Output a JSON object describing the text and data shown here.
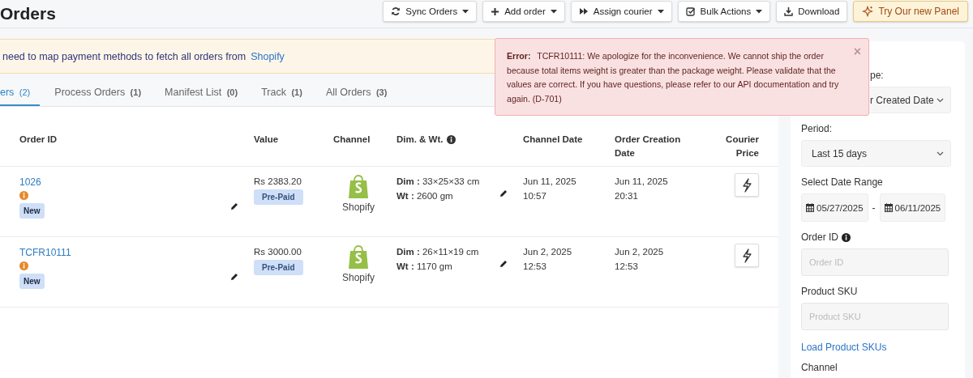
{
  "page": {
    "title": "Orders"
  },
  "toolbar": [
    {
      "label": "Sync Orders",
      "caret": true,
      "kind": "plain"
    },
    {
      "label": "Add order",
      "caret": true,
      "kind": "plain"
    },
    {
      "label": "Assign courier",
      "caret": true,
      "kind": "plain"
    },
    {
      "label": "Bulk Actions",
      "caret": true,
      "kind": "plain"
    },
    {
      "label": "Download",
      "kind": "plain"
    },
    {
      "label": "Try Our new Panel",
      "kind": "promo"
    }
  ],
  "banner": {
    "text": "need to map payment methods to fetch all orders from",
    "link": "Shopify"
  },
  "tabs": [
    {
      "label": "ers",
      "count": "(2)",
      "selected": true
    },
    {
      "label": "Process Orders",
      "count": "(1)",
      "selected": false
    },
    {
      "label": "Manifest List",
      "count": "(0)",
      "selected": false
    },
    {
      "label": "Track",
      "count": "(1)",
      "selected": false
    },
    {
      "label": "All Orders",
      "count": "(3)",
      "selected": false
    }
  ],
  "table": {
    "columns": [
      {
        "label": "Order ID"
      },
      {
        "label": "Value"
      },
      {
        "label": "Channel"
      },
      {
        "label": "Dim. & Wt.",
        "info": true
      },
      {
        "label": "Channel Date"
      },
      {
        "label": "Order Creation Date"
      },
      {
        "label": "Courier Price"
      }
    ],
    "rows": [
      {
        "order_id": "1026",
        "status": "New",
        "value": "Rs 2383.20",
        "payment": "Pre-Paid",
        "channel": "Shopify",
        "dim": "**Dim :** 33×25×33 cm",
        "wt": "**Wt :** 2600 gm",
        "channel_date": [
          "Jun 11, 2025",
          "10:57"
        ],
        "creation_date": [
          "Jun 11, 2025",
          "20:31"
        ]
      },
      {
        "order_id": "TCFR10111",
        "status": "New",
        "value": "Rs 3000.00",
        "payment": "Pre-Paid",
        "channel": "Shopify",
        "dim": "**Dim :** 26×11×19 cm",
        "wt": "**Wt :** 1170 gm",
        "channel_date": [
          "Jun 2, 2025",
          "12:53"
        ],
        "creation_date": [
          "Jun 2, 2025",
          "12:53"
        ]
      }
    ]
  },
  "filters": [
    {
      "kind": "select",
      "label": "pe:",
      "value": "r Created Date"
    },
    {
      "kind": "select",
      "label": "Period:",
      "value": "Last 15 days"
    },
    {
      "kind": "daterange",
      "label": "Select Date Range",
      "from": "05/27/2025",
      "separator": "-",
      "to": "06/11/2025"
    },
    {
      "kind": "input",
      "label": "Order ID",
      "info": true,
      "placeholder": "Order ID"
    },
    {
      "kind": "input",
      "label": "Product SKU",
      "placeholder": "Product SKU"
    },
    {
      "kind": "link",
      "label": "Load Product SKUs"
    },
    {
      "kind": "heading",
      "label": "Channel"
    }
  ],
  "error_popup": {
    "title": "Error:",
    "message": "TCFR10111: We apologize for the inconvenience. We cannot ship the order because total items weight is greater than the package weight. Please validate that the values are correct. If you have questions, please refer to our API documentation and try again. (D-701)",
    "close": "×"
  }
}
